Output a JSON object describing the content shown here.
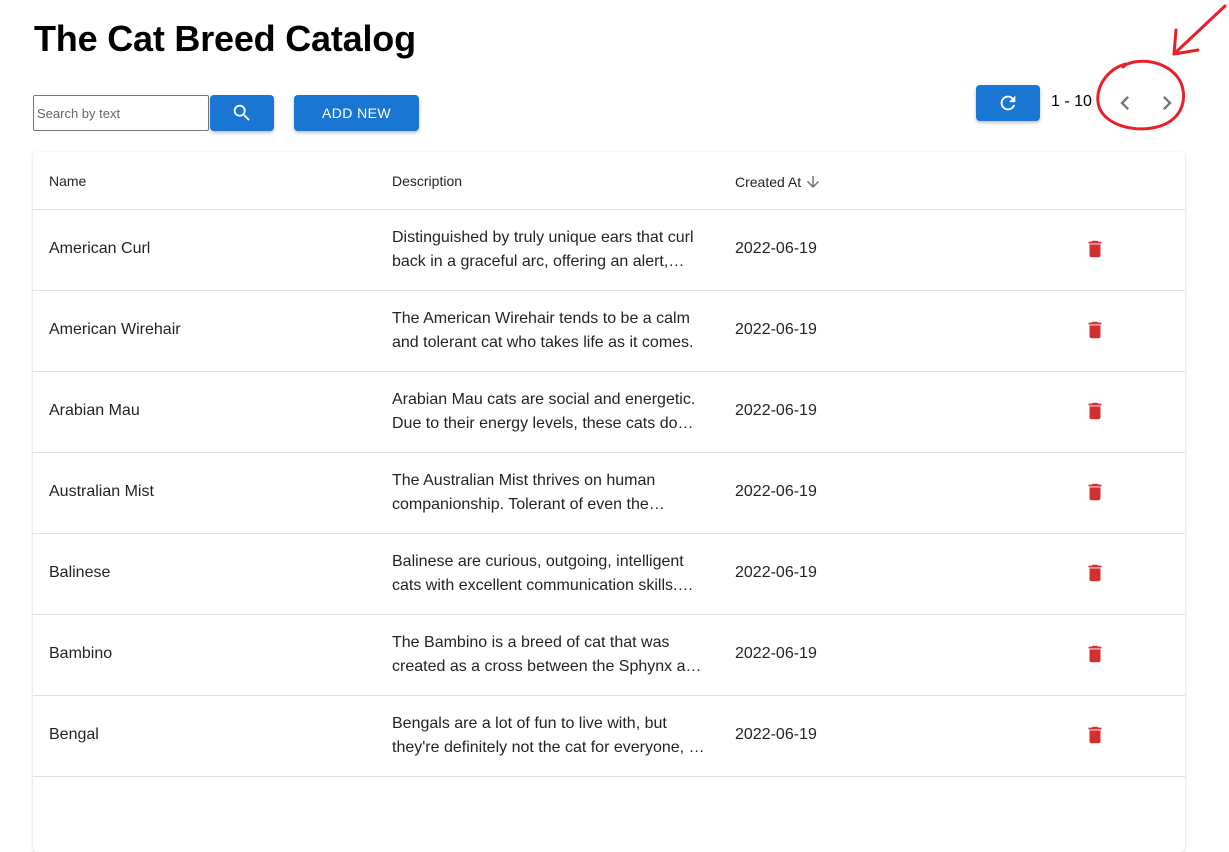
{
  "page": {
    "title": "The Cat Breed Catalog"
  },
  "toolbar": {
    "search_placeholder": "Search by text",
    "add_label": "ADD NEW"
  },
  "pagination": {
    "range_label": "1 - 10"
  },
  "table": {
    "columns": {
      "name": "Name",
      "description": "Description",
      "created_at": "Created At"
    },
    "rows": [
      {
        "name": "American Curl",
        "description": "Distinguished by truly unique ears that curl back in a graceful arc, offering an alert, affectionate and intelligent expression.",
        "created_at": "2022-06-19"
      },
      {
        "name": "American Wirehair",
        "description": "The American Wirehair tends to be a calm and tolerant cat who takes life as it comes.",
        "created_at": "2022-06-19"
      },
      {
        "name": "Arabian Mau",
        "description": "Arabian Mau cats are social and energetic. Due to their energy levels, these cats do best in homes with plenty of space.",
        "created_at": "2022-06-19"
      },
      {
        "name": "Australian Mist",
        "description": "The Australian Mist thrives on human companionship. Tolerant of even the youngest children.",
        "created_at": "2022-06-19"
      },
      {
        "name": "Balinese",
        "description": "Balinese are curious, outgoing, intelligent cats with excellent communication skills. They are known for their chatty personalities.",
        "created_at": "2022-06-19"
      },
      {
        "name": "Bambino",
        "description": "The Bambino is a breed of cat that was created as a cross between the Sphynx and the Munchkin breeds.",
        "created_at": "2022-06-19"
      },
      {
        "name": "Bengal",
        "description": "Bengals are a lot of fun to live with, but they're definitely not the cat for everyone, or for first-time cat owners.",
        "created_at": "2022-06-19"
      }
    ]
  },
  "colors": {
    "primary": "#1976d2",
    "delete": "#d32f2f",
    "annotation": "#e8202a"
  },
  "icons": {
    "search": "search-icon",
    "refresh": "refresh-icon",
    "prev": "chevron-left-icon",
    "next": "chevron-right-icon",
    "sort": "arrow-down-icon",
    "delete": "trash-icon"
  }
}
